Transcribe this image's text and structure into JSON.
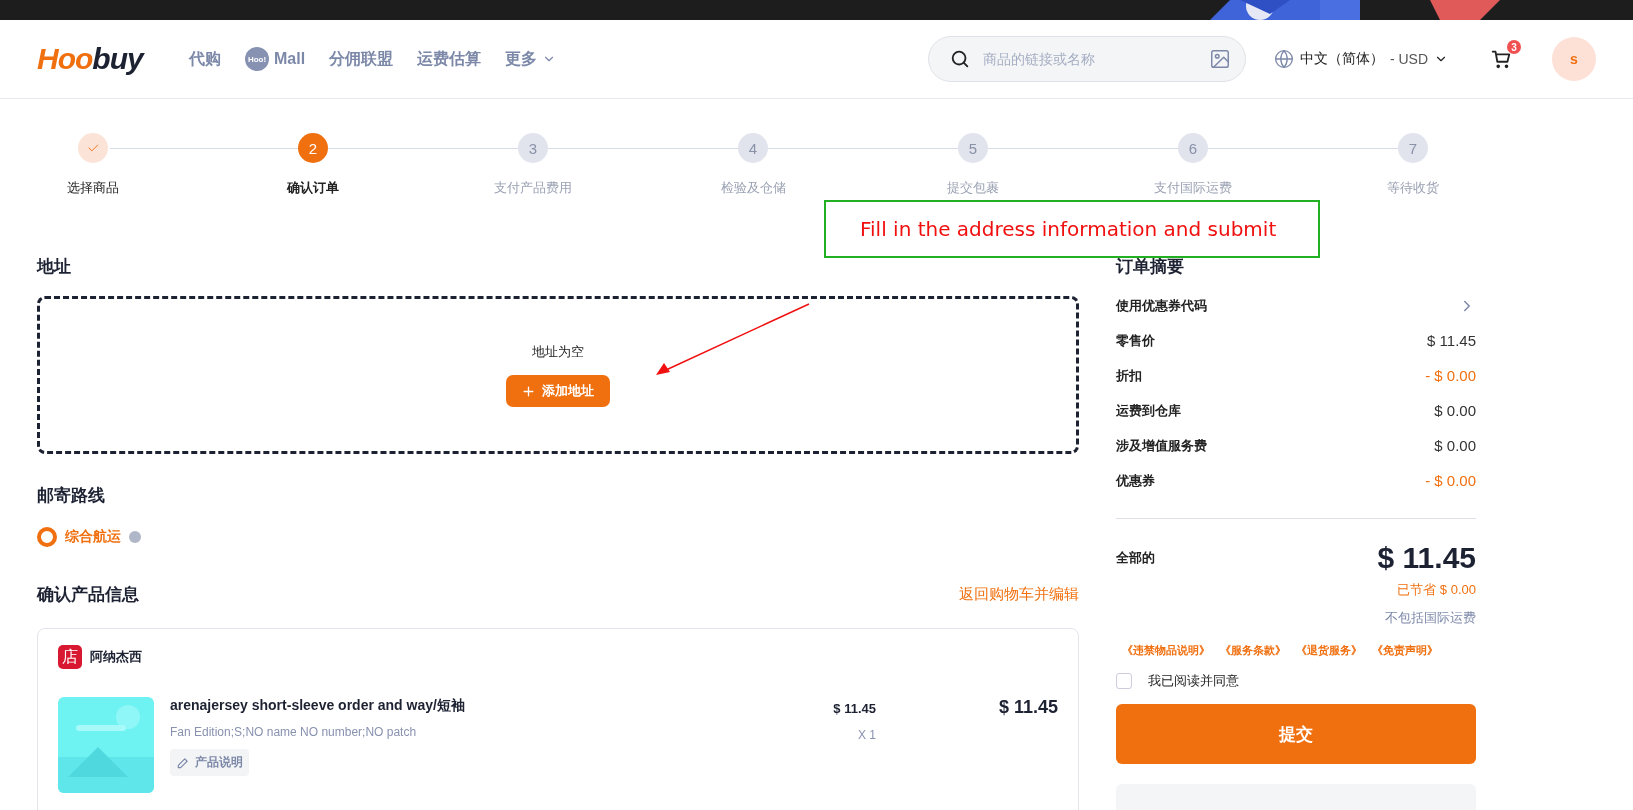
{
  "header": {
    "logo_parts": [
      "Hoo",
      "buy"
    ],
    "nav": [
      {
        "kind": "text",
        "label": "代购"
      },
      {
        "kind": "mall",
        "badge": "Hoo!",
        "label": "Mall"
      },
      {
        "kind": "text",
        "label": "分佣联盟"
      },
      {
        "kind": "text",
        "label": "运费估算"
      },
      {
        "kind": "dropdown",
        "label": "更多"
      }
    ],
    "search": {
      "placeholder": "商品的链接或名称"
    },
    "language": "中文（简体）",
    "currency": "- USD",
    "cart_count": "3",
    "avatar": "s"
  },
  "steps": [
    {
      "label": "选择商品",
      "completed": true,
      "selected": false
    },
    {
      "number": "2",
      "label": "确认订单",
      "completed": false,
      "selected": true
    },
    {
      "number": "3",
      "label": "支付产品费用",
      "completed": false,
      "selected": false
    },
    {
      "number": "4",
      "label": "检验及仓储",
      "completed": false,
      "selected": false
    },
    {
      "number": "5",
      "label": "提交包裹",
      "completed": false,
      "selected": false
    },
    {
      "number": "6",
      "label": "支付国际运费",
      "completed": false,
      "selected": false
    },
    {
      "number": "7",
      "label": "等待收货",
      "completed": false,
      "selected": false
    }
  ],
  "address": {
    "title": "地址",
    "empty_text": "地址为空",
    "add_button": "添加地址"
  },
  "shipping": {
    "title": "邮寄路线",
    "options": [
      {
        "label": "综合航运",
        "selected": true
      }
    ]
  },
  "products": {
    "title": "确认产品信息",
    "back_link": "返回购物车并编辑",
    "store": {
      "icon": "店",
      "name": "阿纳杰西"
    },
    "items": [
      {
        "title": "arenajersey short-sleeve order and way/短袖",
        "specs": "Fan Edition;S;NO name NO number;NO patch",
        "note_button": "产品说明",
        "unit_price": "$ 11.45",
        "quantity": "X 1",
        "total": "$ 11.45"
      }
    ]
  },
  "summary": {
    "title": "订单摘要",
    "coupon_code": "使用优惠券代码",
    "rows": [
      {
        "label": "零售价",
        "value": "$ 11.45",
        "kind": "plain"
      },
      {
        "label": "折扣",
        "value": "- $ 0.00",
        "kind": "deduction"
      },
      {
        "label": "运费到仓库",
        "value": "$ 0.00",
        "kind": "plain"
      },
      {
        "label": "涉及增值服务费",
        "value": "$ 0.00",
        "kind": "plain"
      },
      {
        "label": "优惠券",
        "value": "- $ 0.00",
        "kind": "deduction"
      }
    ],
    "total_label": "全部的",
    "total": "$ 11.45",
    "saved": "已节省 $ 0.00",
    "note": "不包括国际运费",
    "legal_links": [
      "《违禁物品说明》",
      "《服务条款》",
      "《退货服务》",
      "《免责声明》"
    ],
    "agree": {
      "label": "我已阅读并同意",
      "checked": false
    },
    "submit": "提交"
  },
  "annotation": {
    "text": "Fill in the address information and submit"
  }
}
